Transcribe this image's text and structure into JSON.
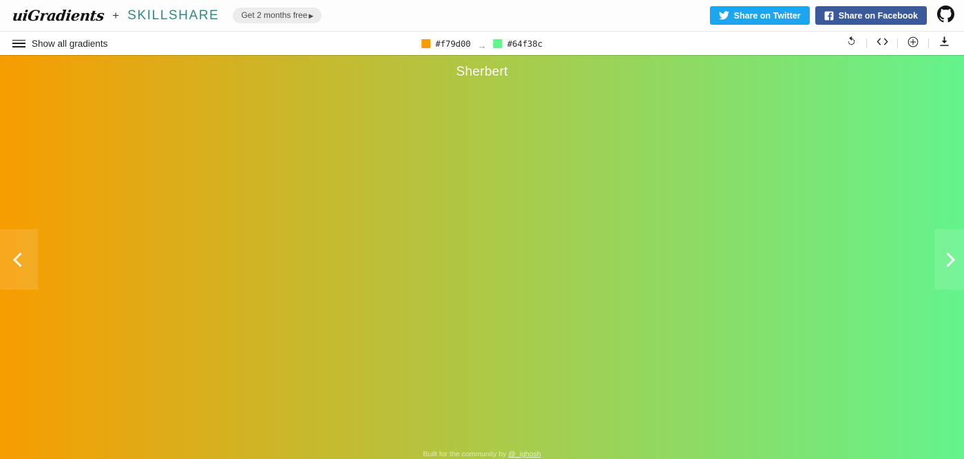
{
  "header": {
    "logo_text": "uiGradients",
    "plus": "+",
    "partner": "SKILLSHARE",
    "promo_label": "Get 2 months free",
    "promo_caret": "▶",
    "twitter_label": "Share on Twitter",
    "facebook_label": "Share on Facebook",
    "github_title": "GitHub",
    "twitter_color": "#1da6f0",
    "facebook_color": "#3b5a9b",
    "partner_color": "#2f8a86"
  },
  "toolbar": {
    "show_all_label": "Show all gradients",
    "menu_icon": "hamburger-icon",
    "color_start_hex": "#f79d00",
    "color_end_hex": "#64f38c",
    "arrow": "→",
    "actions": [
      {
        "name": "rotate-gradient-button",
        "icon": "rotate-icon",
        "title": "Rotate gradient"
      },
      {
        "name": "view-code-button",
        "icon": "code-icon",
        "title": "Get CSS code"
      },
      {
        "name": "add-gradient-button",
        "icon": "plus-circle-icon",
        "title": "Add gradient"
      },
      {
        "name": "download-button",
        "icon": "download-icon",
        "title": "Download"
      }
    ]
  },
  "stage": {
    "gradient_name": "Sherbert",
    "gradient_from": "#f79d00",
    "gradient_to": "#64f38c",
    "gradient_angle": "90deg",
    "prev_label": "Previous gradient",
    "next_label": "Next gradient",
    "footer_prefix": "Built for the community by ",
    "footer_handle": "@_ighosh"
  }
}
